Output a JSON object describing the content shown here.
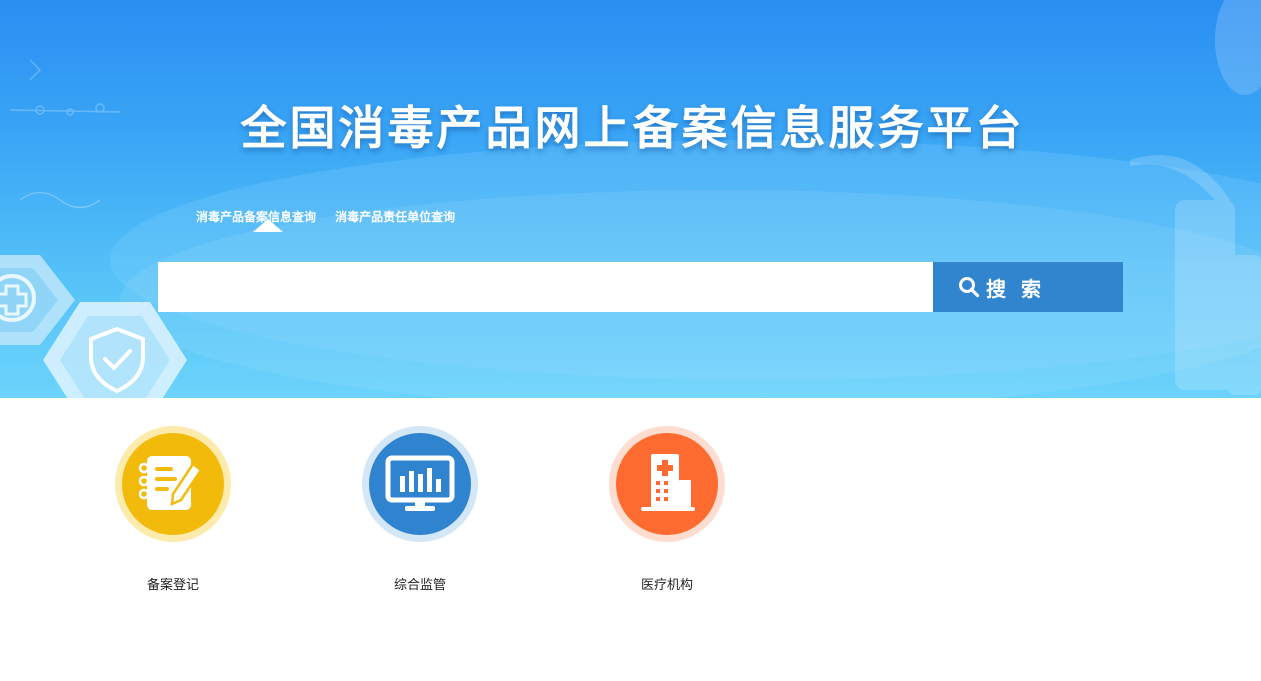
{
  "header": {
    "title": "全国消毒产品网上备案信息服务平台"
  },
  "tabs": [
    {
      "label": "消毒产品备案信息查询",
      "active": true
    },
    {
      "label": "消毒产品责任单位查询",
      "active": false
    }
  ],
  "search": {
    "placeholder": "",
    "value": "",
    "button_label": "搜 索",
    "button_icon": "search-icon"
  },
  "services": [
    {
      "label": "备案登记",
      "icon": "notebook-pen-icon",
      "color": "#f2bb0b",
      "ring": "#fde9a4"
    },
    {
      "label": "综合监管",
      "icon": "monitor-chart-icon",
      "color": "#3083cf",
      "ring": "#cfe4f6"
    },
    {
      "label": "医疗机构",
      "icon": "hospital-icon",
      "color": "#fe6b31",
      "ring": "#fdd9cb"
    }
  ],
  "colors": {
    "banner_top": "#2a8ef2",
    "banner_bottom": "#6bd3fb",
    "search_button": "#3185cf"
  }
}
